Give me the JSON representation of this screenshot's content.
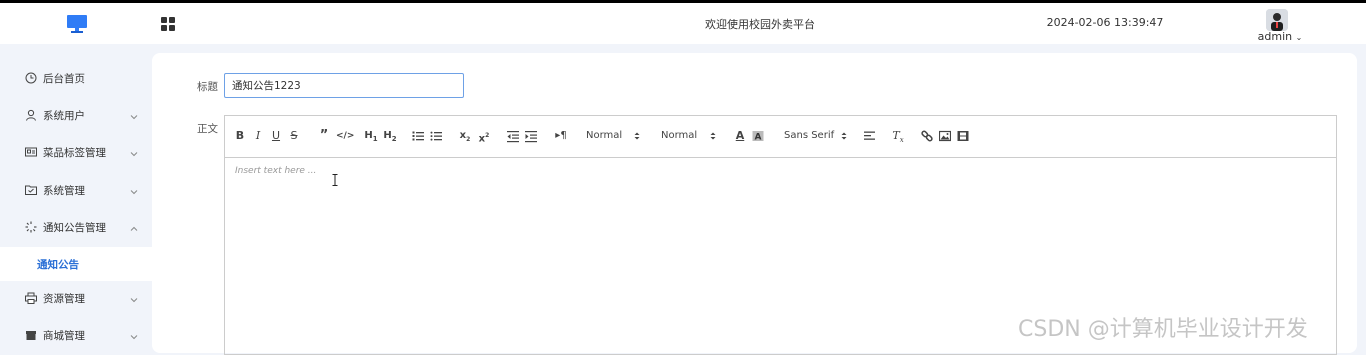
{
  "header": {
    "site_title": "欢迎使用校园外卖平台",
    "datetime": "2024-02-06 13:39:47",
    "user_name": "admin"
  },
  "sidebar": {
    "items": [
      {
        "label": "后台首页",
        "icon": "clock-icon"
      },
      {
        "label": "系统用户",
        "icon": "user-icon",
        "arrow": "chevron-down"
      },
      {
        "label": "菜品标签管理",
        "icon": "id-card-icon",
        "arrow": "chevron-down"
      },
      {
        "label": "系统管理",
        "icon": "folder-check-icon",
        "arrow": "chevron-down"
      },
      {
        "label": "通知公告管理",
        "icon": "loading-icon",
        "arrow": "chevron-up"
      },
      {
        "label": "资源管理",
        "icon": "printer-icon",
        "arrow": "chevron-down"
      },
      {
        "label": "商城管理",
        "icon": "shop-icon",
        "arrow": "chevron-down"
      }
    ],
    "active_sub_item": "通知公告"
  },
  "form": {
    "title_label": "标题",
    "title_value": "通知公告1223",
    "body_label": "正文",
    "editor": {
      "placeholder": "Insert text here ...",
      "size_picker": "Normal",
      "header_picker": "Normal",
      "font_picker": "Sans Serif"
    }
  },
  "watermark": "CSDN @计算机毕业设计开发",
  "colors": {
    "accent": "#2a6fd6",
    "input_border": "#6ea1e6",
    "background": "#f1f4fa"
  }
}
